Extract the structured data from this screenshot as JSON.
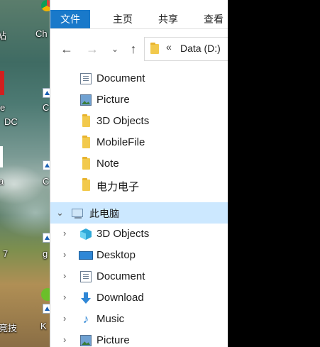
{
  "desktop": {
    "labels": [
      "站",
      "Ch",
      "e",
      "DC",
      "C",
      "a",
      "C",
      "7",
      "g",
      "竞技",
      "K"
    ]
  },
  "ribbon": {
    "tabs": [
      {
        "label": "文件",
        "active": true
      },
      {
        "label": "主页",
        "active": false
      },
      {
        "label": "共享",
        "active": false
      },
      {
        "label": "查看",
        "active": false
      }
    ]
  },
  "navigation": {
    "back_glyph": "←",
    "forward_glyph": "→",
    "recent_glyph": "⌄",
    "up_glyph": "↑",
    "address_overflow": "«",
    "address_text": "Data (D:)"
  },
  "quick_access": [
    {
      "label": "Document",
      "icon": "document-icon"
    },
    {
      "label": "Picture",
      "icon": "picture-icon"
    },
    {
      "label": "3D Objects",
      "icon": "folder-icon"
    },
    {
      "label": "MobileFile",
      "icon": "folder-icon"
    },
    {
      "label": "Note",
      "icon": "folder-icon"
    },
    {
      "label": "电力电子",
      "icon": "folder-icon"
    }
  ],
  "this_pc": {
    "label": "此电脑",
    "expand_glyph": "⌄",
    "selected": true
  },
  "pc_children": [
    {
      "label": "3D Objects",
      "icon": "3d-objects-icon"
    },
    {
      "label": "Desktop",
      "icon": "desktop-icon"
    },
    {
      "label": "Document",
      "icon": "document-icon"
    },
    {
      "label": "Download",
      "icon": "download-icon"
    },
    {
      "label": "Music",
      "icon": "music-icon"
    },
    {
      "label": "Picture",
      "icon": "picture-icon"
    }
  ],
  "child_expand_glyph": "›",
  "music_glyph": "♪",
  "colors": {
    "accent": "#1979ca",
    "selection": "#cce8ff",
    "folder": "#f2c94c"
  }
}
